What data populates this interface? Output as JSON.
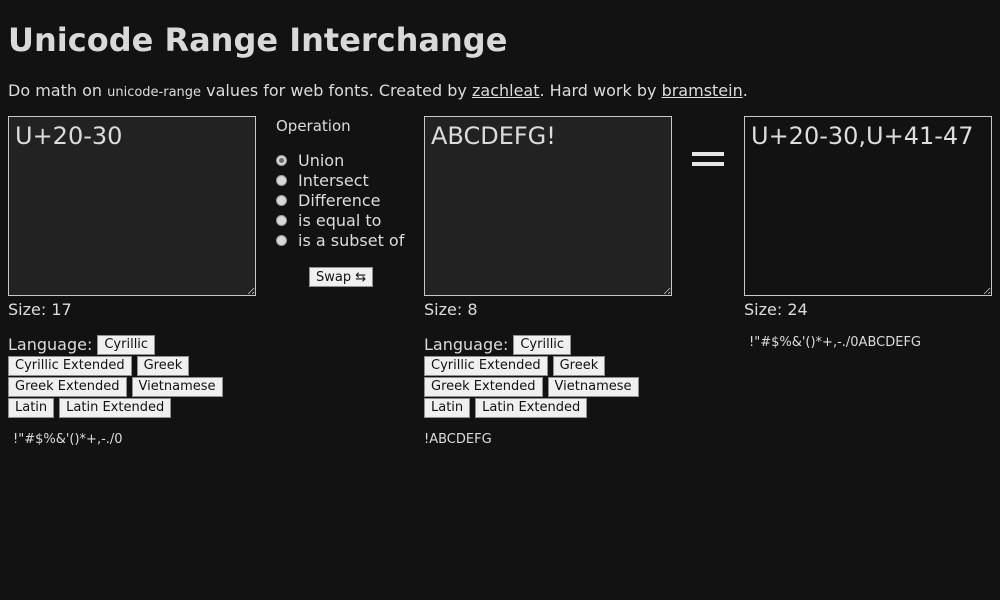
{
  "header": {
    "title": "Unicode Range Interchange",
    "intro_prefix": "Do math on ",
    "intro_code": "unicode-range",
    "intro_middle": " values for web fonts. Created by ",
    "creator_link": "zachleat",
    "intro_mid2": ". Hard work by ",
    "helper_link": "bramstein",
    "intro_suffix": "."
  },
  "left": {
    "value": "U+20-30",
    "size_label": "Size: 17",
    "language_label": "Language:",
    "languages": [
      "Cyrillic",
      "Cyrillic Extended",
      "Greek",
      "Greek Extended",
      "Vietnamese",
      "Latin",
      "Latin Extended"
    ],
    "chars": "!\"#$%&'()*+,-./0"
  },
  "operation": {
    "legend": "Operation",
    "options": [
      "Union",
      "Intersect",
      "Difference",
      "is equal to",
      "is a subset of"
    ],
    "selected": "Union",
    "swap_label": "Swap ⇆"
  },
  "right": {
    "value": "ABCDEFG!",
    "size_label": "Size: 8",
    "language_label": "Language:",
    "languages": [
      "Cyrillic",
      "Cyrillic Extended",
      "Greek",
      "Greek Extended",
      "Vietnamese",
      "Latin",
      "Latin Extended"
    ],
    "chars": "!ABCDEFG"
  },
  "result": {
    "value": "U+20-30,U+41-47",
    "size_label": "Size: 24",
    "chars": "!\"#$%&'()*+,-./0ABCDEFG"
  }
}
